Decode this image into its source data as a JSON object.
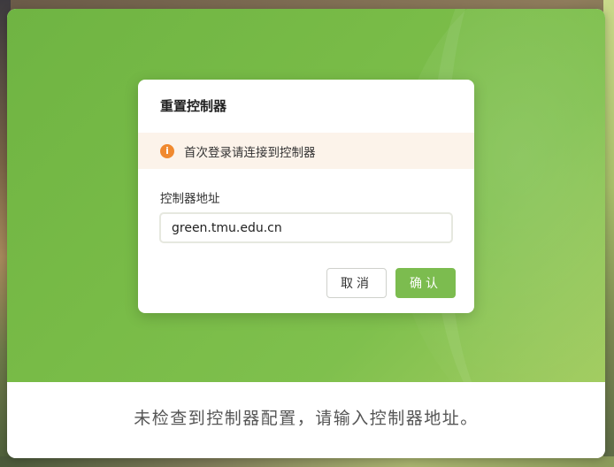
{
  "dialog": {
    "title": "重置控制器",
    "alert": {
      "icon": "info-icon",
      "icon_glyph": "i",
      "text": "首次登录请连接到控制器",
      "color": "#f0892f"
    },
    "field_label": "控制器地址",
    "field_value": "green.tmu.edu.cn",
    "cancel_label": "取消",
    "ok_label": "确认"
  },
  "footer": {
    "message": "未检查到控制器配置，请输入控制器地址。"
  },
  "colors": {
    "accent": "#7cbc4f",
    "hero": "#78bb47",
    "alert_bg": "#fcf3ea",
    "alert_icon": "#f0892f"
  }
}
